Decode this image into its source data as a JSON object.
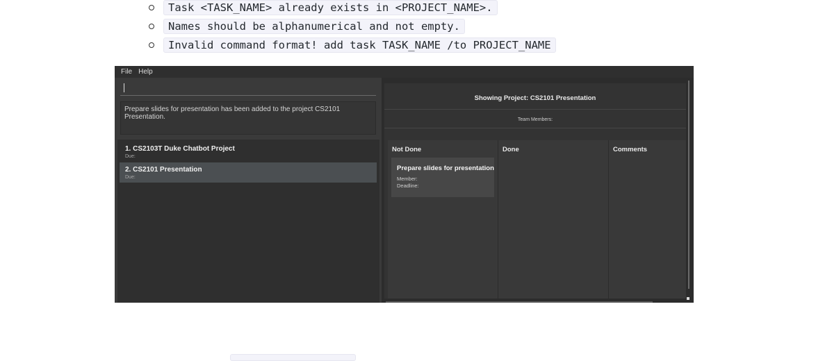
{
  "doc": {
    "messages": [
      "Task <TASK_NAME> already exists in <PROJECT_NAME>.",
      "Names should be alphanumerical and not empty.",
      "Invalid command format! add task TASK_NAME /to PROJECT_NAME"
    ]
  },
  "app": {
    "menu": [
      "File",
      "Help"
    ],
    "command_input": {
      "value": ""
    },
    "result": "Prepare slides for presentation has been added to the project CS2101 Presentation.",
    "projects": [
      {
        "name": "1.  CS2103T Duke Chatbot Project",
        "due": "Due:"
      },
      {
        "name": "2.  CS2101 Presentation",
        "due": "Due:",
        "selected": true
      }
    ],
    "project_view": {
      "title": "Showing Project: CS2101 Presentation",
      "members_label": "Team Members:",
      "columns": [
        "Not Done",
        "Done",
        "Comments"
      ],
      "tasks": [
        {
          "name": "Prepare slides for presentation",
          "member_label": "Member:",
          "deadline_label": "Deadline:"
        }
      ]
    }
  }
}
